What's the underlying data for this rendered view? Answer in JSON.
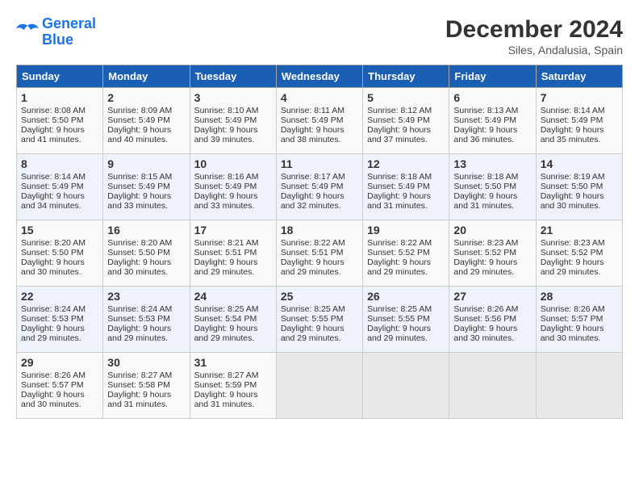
{
  "header": {
    "logo_line1": "General",
    "logo_line2": "Blue",
    "title": "December 2024",
    "subtitle": "Siles, Andalusia, Spain"
  },
  "weekdays": [
    "Sunday",
    "Monday",
    "Tuesday",
    "Wednesday",
    "Thursday",
    "Friday",
    "Saturday"
  ],
  "weeks": [
    [
      {
        "day": "1",
        "lines": [
          "Sunrise: 8:08 AM",
          "Sunset: 5:50 PM",
          "Daylight: 9 hours",
          "and 41 minutes."
        ]
      },
      {
        "day": "2",
        "lines": [
          "Sunrise: 8:09 AM",
          "Sunset: 5:49 PM",
          "Daylight: 9 hours",
          "and 40 minutes."
        ]
      },
      {
        "day": "3",
        "lines": [
          "Sunrise: 8:10 AM",
          "Sunset: 5:49 PM",
          "Daylight: 9 hours",
          "and 39 minutes."
        ]
      },
      {
        "day": "4",
        "lines": [
          "Sunrise: 8:11 AM",
          "Sunset: 5:49 PM",
          "Daylight: 9 hours",
          "and 38 minutes."
        ]
      },
      {
        "day": "5",
        "lines": [
          "Sunrise: 8:12 AM",
          "Sunset: 5:49 PM",
          "Daylight: 9 hours",
          "and 37 minutes."
        ]
      },
      {
        "day": "6",
        "lines": [
          "Sunrise: 8:13 AM",
          "Sunset: 5:49 PM",
          "Daylight: 9 hours",
          "and 36 minutes."
        ]
      },
      {
        "day": "7",
        "lines": [
          "Sunrise: 8:14 AM",
          "Sunset: 5:49 PM",
          "Daylight: 9 hours",
          "and 35 minutes."
        ]
      }
    ],
    [
      {
        "day": "8",
        "lines": [
          "Sunrise: 8:14 AM",
          "Sunset: 5:49 PM",
          "Daylight: 9 hours",
          "and 34 minutes."
        ]
      },
      {
        "day": "9",
        "lines": [
          "Sunrise: 8:15 AM",
          "Sunset: 5:49 PM",
          "Daylight: 9 hours",
          "and 33 minutes."
        ]
      },
      {
        "day": "10",
        "lines": [
          "Sunrise: 8:16 AM",
          "Sunset: 5:49 PM",
          "Daylight: 9 hours",
          "and 33 minutes."
        ]
      },
      {
        "day": "11",
        "lines": [
          "Sunrise: 8:17 AM",
          "Sunset: 5:49 PM",
          "Daylight: 9 hours",
          "and 32 minutes."
        ]
      },
      {
        "day": "12",
        "lines": [
          "Sunrise: 8:18 AM",
          "Sunset: 5:49 PM",
          "Daylight: 9 hours",
          "and 31 minutes."
        ]
      },
      {
        "day": "13",
        "lines": [
          "Sunrise: 8:18 AM",
          "Sunset: 5:50 PM",
          "Daylight: 9 hours",
          "and 31 minutes."
        ]
      },
      {
        "day": "14",
        "lines": [
          "Sunrise: 8:19 AM",
          "Sunset: 5:50 PM",
          "Daylight: 9 hours",
          "and 30 minutes."
        ]
      }
    ],
    [
      {
        "day": "15",
        "lines": [
          "Sunrise: 8:20 AM",
          "Sunset: 5:50 PM",
          "Daylight: 9 hours",
          "and 30 minutes."
        ]
      },
      {
        "day": "16",
        "lines": [
          "Sunrise: 8:20 AM",
          "Sunset: 5:50 PM",
          "Daylight: 9 hours",
          "and 30 minutes."
        ]
      },
      {
        "day": "17",
        "lines": [
          "Sunrise: 8:21 AM",
          "Sunset: 5:51 PM",
          "Daylight: 9 hours",
          "and 29 minutes."
        ]
      },
      {
        "day": "18",
        "lines": [
          "Sunrise: 8:22 AM",
          "Sunset: 5:51 PM",
          "Daylight: 9 hours",
          "and 29 minutes."
        ]
      },
      {
        "day": "19",
        "lines": [
          "Sunrise: 8:22 AM",
          "Sunset: 5:52 PM",
          "Daylight: 9 hours",
          "and 29 minutes."
        ]
      },
      {
        "day": "20",
        "lines": [
          "Sunrise: 8:23 AM",
          "Sunset: 5:52 PM",
          "Daylight: 9 hours",
          "and 29 minutes."
        ]
      },
      {
        "day": "21",
        "lines": [
          "Sunrise: 8:23 AM",
          "Sunset: 5:52 PM",
          "Daylight: 9 hours",
          "and 29 minutes."
        ]
      }
    ],
    [
      {
        "day": "22",
        "lines": [
          "Sunrise: 8:24 AM",
          "Sunset: 5:53 PM",
          "Daylight: 9 hours",
          "and 29 minutes."
        ]
      },
      {
        "day": "23",
        "lines": [
          "Sunrise: 8:24 AM",
          "Sunset: 5:53 PM",
          "Daylight: 9 hours",
          "and 29 minutes."
        ]
      },
      {
        "day": "24",
        "lines": [
          "Sunrise: 8:25 AM",
          "Sunset: 5:54 PM",
          "Daylight: 9 hours",
          "and 29 minutes."
        ]
      },
      {
        "day": "25",
        "lines": [
          "Sunrise: 8:25 AM",
          "Sunset: 5:55 PM",
          "Daylight: 9 hours",
          "and 29 minutes."
        ]
      },
      {
        "day": "26",
        "lines": [
          "Sunrise: 8:25 AM",
          "Sunset: 5:55 PM",
          "Daylight: 9 hours",
          "and 29 minutes."
        ]
      },
      {
        "day": "27",
        "lines": [
          "Sunrise: 8:26 AM",
          "Sunset: 5:56 PM",
          "Daylight: 9 hours",
          "and 30 minutes."
        ]
      },
      {
        "day": "28",
        "lines": [
          "Sunrise: 8:26 AM",
          "Sunset: 5:57 PM",
          "Daylight: 9 hours",
          "and 30 minutes."
        ]
      }
    ],
    [
      {
        "day": "29",
        "lines": [
          "Sunrise: 8:26 AM",
          "Sunset: 5:57 PM",
          "Daylight: 9 hours",
          "and 30 minutes."
        ]
      },
      {
        "day": "30",
        "lines": [
          "Sunrise: 8:27 AM",
          "Sunset: 5:58 PM",
          "Daylight: 9 hours",
          "and 31 minutes."
        ]
      },
      {
        "day": "31",
        "lines": [
          "Sunrise: 8:27 AM",
          "Sunset: 5:59 PM",
          "Daylight: 9 hours",
          "and 31 minutes."
        ]
      },
      null,
      null,
      null,
      null
    ]
  ]
}
